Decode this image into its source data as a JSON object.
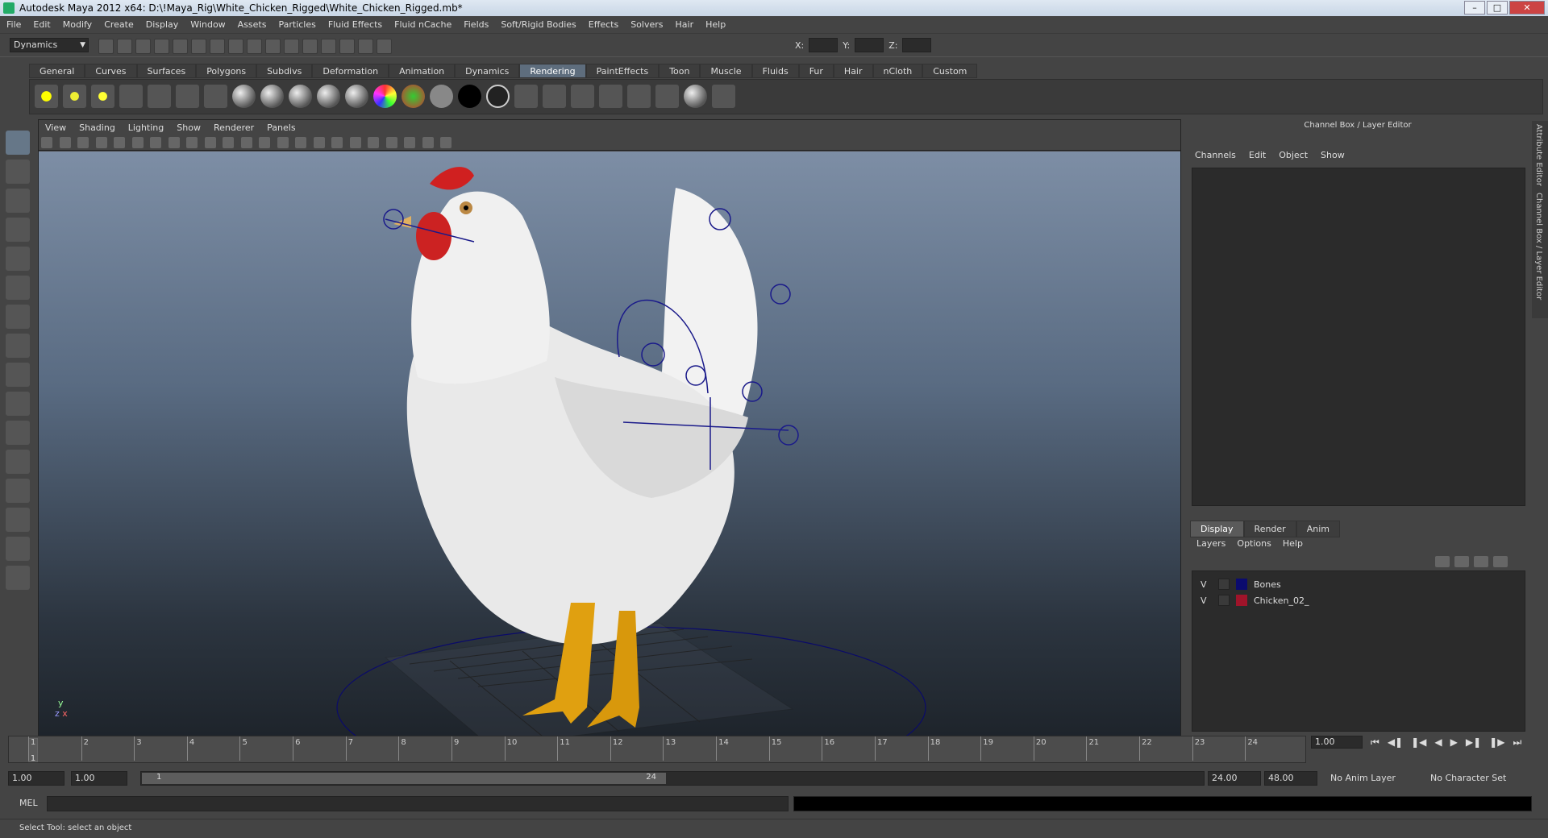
{
  "window": {
    "title": "Autodesk Maya 2012 x64: D:\\!Maya_Rig\\White_Chicken_Rigged\\White_Chicken_Rigged.mb*"
  },
  "menubar": [
    "File",
    "Edit",
    "Modify",
    "Create",
    "Display",
    "Window",
    "Assets",
    "Particles",
    "Fluid Effects",
    "Fluid nCache",
    "Fields",
    "Soft/Rigid Bodies",
    "Effects",
    "Solvers",
    "Hair",
    "Help"
  ],
  "toolbar": {
    "mode": "Dynamics",
    "x_label": "X:",
    "y_label": "Y:",
    "z_label": "Z:"
  },
  "shelf_tabs": [
    "General",
    "Curves",
    "Surfaces",
    "Polygons",
    "Subdivs",
    "Deformation",
    "Animation",
    "Dynamics",
    "Rendering",
    "PaintEffects",
    "Toon",
    "Muscle",
    "Fluids",
    "Fur",
    "Hair",
    "nCloth",
    "Custom"
  ],
  "active_shelf_tab": "Rendering",
  "viewport": {
    "menu": [
      "View",
      "Shading",
      "Lighting",
      "Show",
      "Renderer",
      "Panels"
    ],
    "axis_y": "y",
    "axis_x": "x",
    "axis_z": "z"
  },
  "channel_box": {
    "title": "Channel Box / Layer Editor",
    "menu": [
      "Channels",
      "Edit",
      "Object",
      "Show"
    ]
  },
  "layer_editor": {
    "tabs": [
      "Display",
      "Render",
      "Anim"
    ],
    "menu": [
      "Layers",
      "Options",
      "Help"
    ],
    "layers": [
      {
        "visible": "V",
        "name": "Bones",
        "color": "#0b0b6e"
      },
      {
        "visible": "V",
        "name": "Chicken_02_",
        "color": "#a0142a"
      }
    ]
  },
  "side_tabs": [
    "Attribute Editor",
    "Channel Box / Layer Editor"
  ],
  "timeline": {
    "ticks": [
      "1",
      "2",
      "3",
      "4",
      "5",
      "6",
      "7",
      "8",
      "9",
      "10",
      "11",
      "12",
      "13",
      "14",
      "15",
      "16",
      "17",
      "18",
      "19",
      "20",
      "21",
      "22",
      "23",
      "24"
    ],
    "current_frame": "1",
    "current_time_field": "1.00"
  },
  "range": {
    "start": "1.00",
    "anim_start": "1.00",
    "slider_start": "1",
    "slider_end": "24",
    "anim_end": "24.00",
    "end": "48.00",
    "anim_layer": "No Anim Layer",
    "char_set": "No Character Set"
  },
  "command_line": {
    "label": "MEL"
  },
  "help_line": "Select Tool: select an object"
}
